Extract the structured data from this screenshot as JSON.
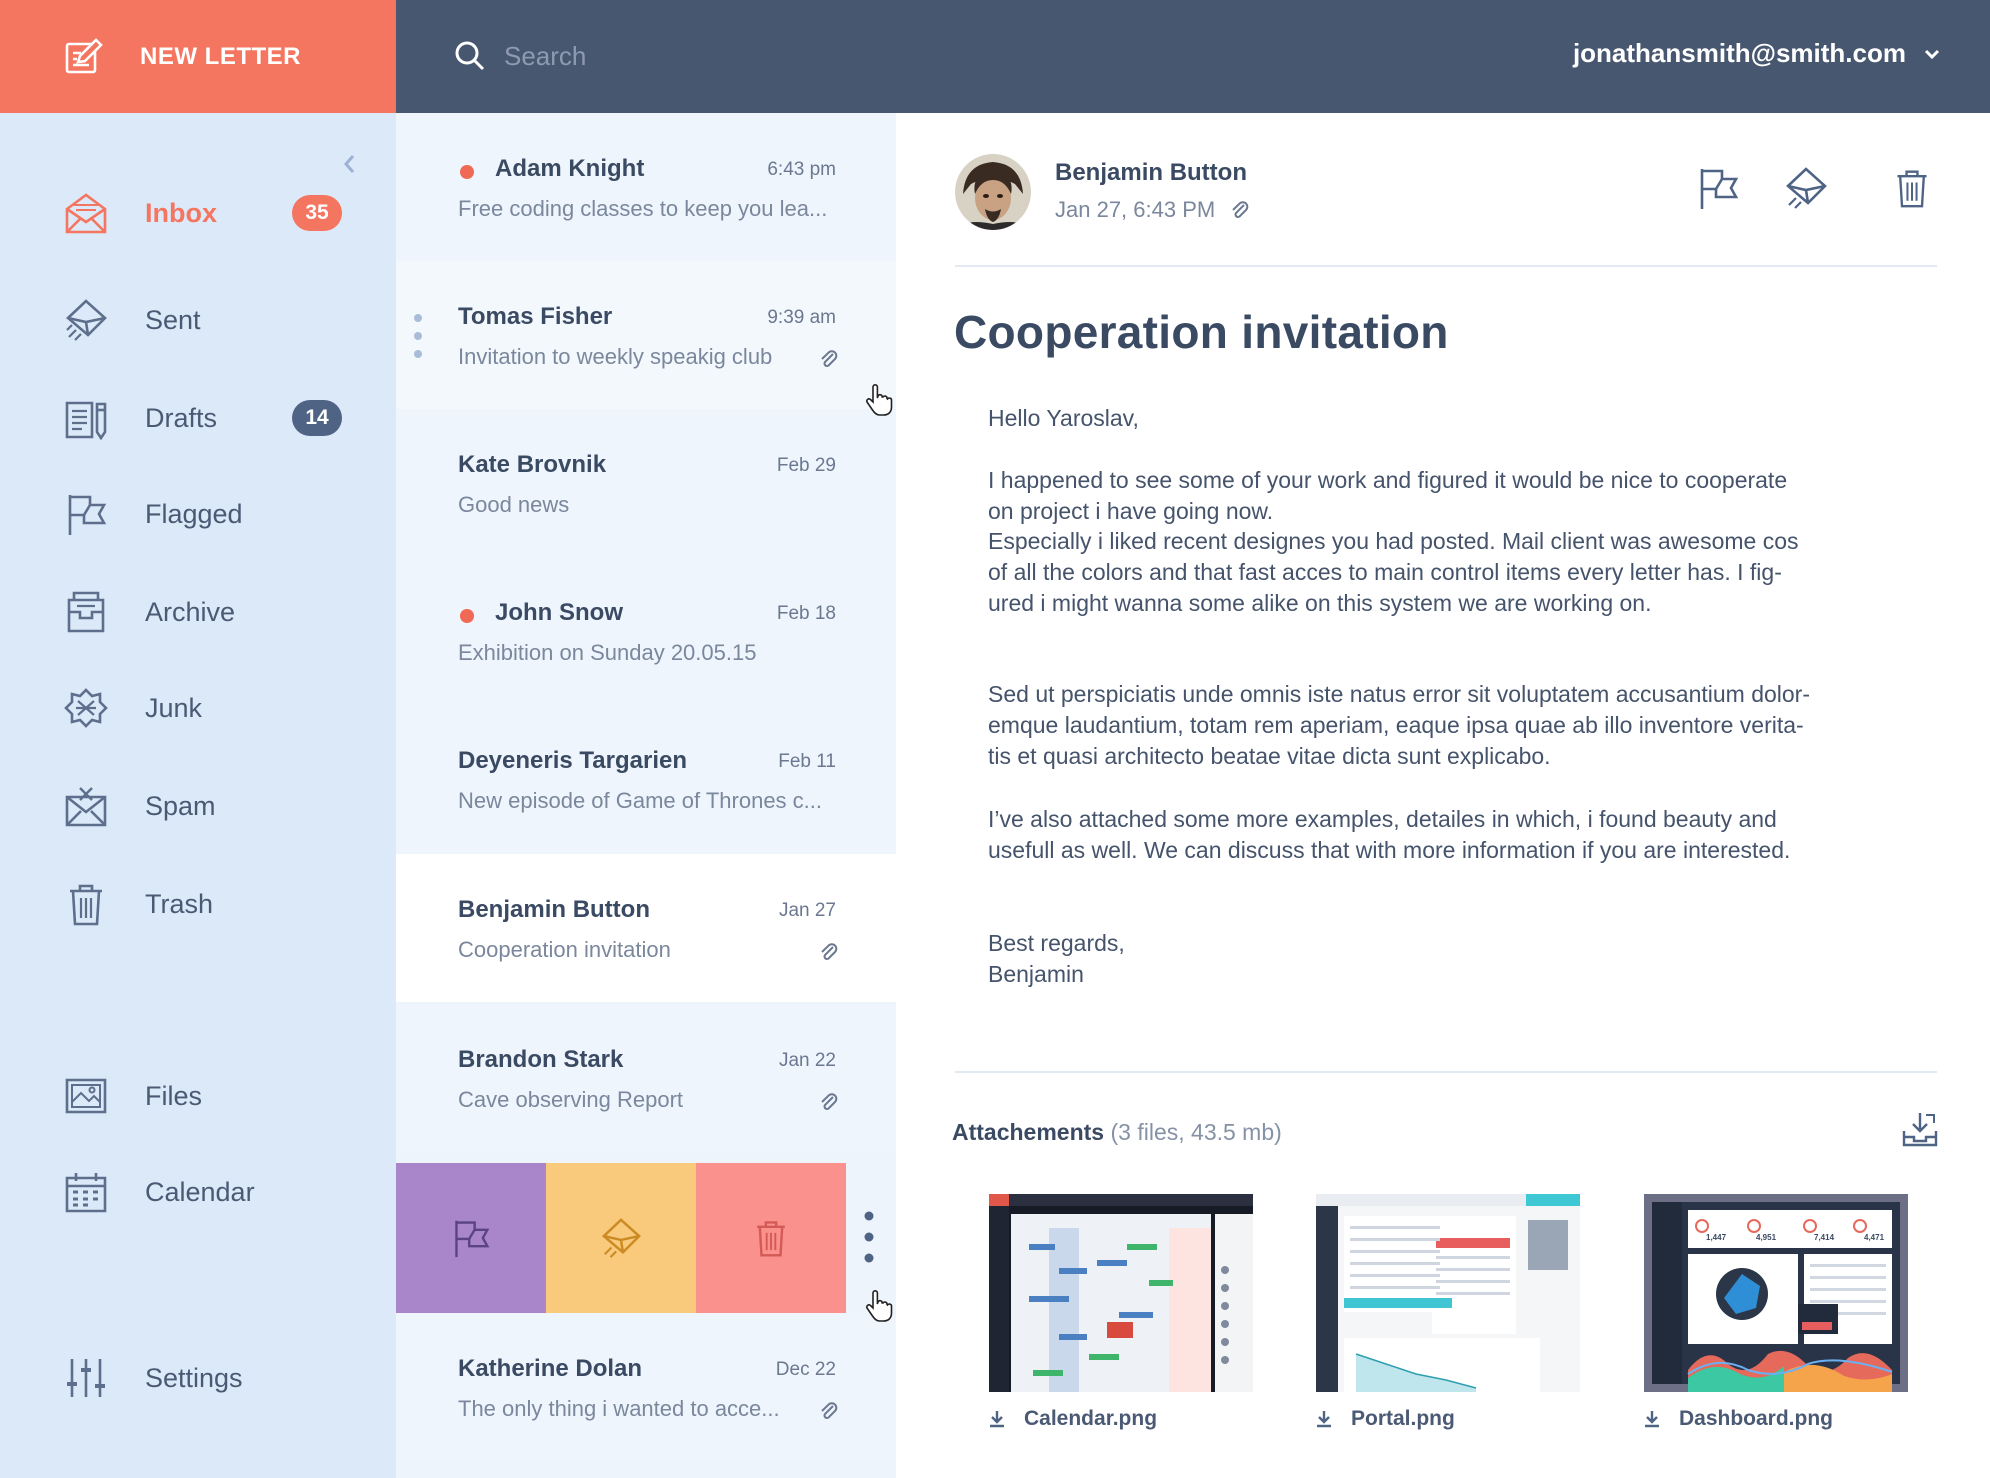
{
  "compose": {
    "label": "NEW LETTER",
    "icon": "compose-icon"
  },
  "search": {
    "placeholder": "Search",
    "icon": "search-icon"
  },
  "account": {
    "email": "jonathansmith@smith.com",
    "icon": "chevron-down-icon"
  },
  "colors": {
    "accent": "#f47560",
    "topbar": "#475770",
    "sidebar": "#dce9f8",
    "badge_blue": "#4f6385",
    "swipe_flag": "#a985c9",
    "swipe_read": "#f9c97c",
    "swipe_delete": "#fb918d"
  },
  "sidebar": {
    "items": [
      {
        "label": "Inbox",
        "badge": "35",
        "icon": "inbox-icon",
        "active": true
      },
      {
        "label": "Sent",
        "icon": "sent-icon"
      },
      {
        "label": "Drafts",
        "badge": "14",
        "icon": "drafts-icon"
      },
      {
        "label": "Flagged",
        "icon": "flag-icon"
      },
      {
        "label": "Archive",
        "icon": "archive-icon"
      },
      {
        "label": "Junk",
        "icon": "junk-icon"
      },
      {
        "label": "Spam",
        "icon": "spam-icon"
      },
      {
        "label": "Trash",
        "icon": "trash-icon"
      },
      {
        "label": "Files",
        "icon": "files-icon"
      },
      {
        "label": "Calendar",
        "icon": "calendar-icon"
      },
      {
        "label": "Settings",
        "icon": "settings-icon"
      }
    ]
  },
  "messages": [
    {
      "sender": "Adam Knight",
      "date": "6:43 pm",
      "subject": "Free coding classes to keep you lea...",
      "unread": true,
      "attachment": false
    },
    {
      "sender": "Tomas Fisher",
      "date": "9:39 am",
      "subject": "Invitation to weekly speakig club",
      "unread": false,
      "attachment": true
    },
    {
      "sender": "Kate Brovnik",
      "date": "Feb 29",
      "subject": "Good news",
      "unread": false,
      "attachment": false
    },
    {
      "sender": "John Snow",
      "date": "Feb 18",
      "subject": "Exhibition on Sunday 20.05.15",
      "unread": true,
      "attachment": false
    },
    {
      "sender": "Deyeneris Targarien",
      "date": "Feb 11",
      "subject": "New episode of Game of Thrones c...",
      "unread": false,
      "attachment": false
    },
    {
      "sender": "Benjamin Button",
      "date": "Jan 27",
      "subject": "Cooperation invitation",
      "unread": false,
      "attachment": true,
      "selected": true
    },
    {
      "sender": "Brandon Stark",
      "date": "Jan 22",
      "subject": "Cave observing Report",
      "unread": false,
      "attachment": true
    },
    {
      "sender": "Katherine Dolan",
      "date": "Dec 22",
      "subject": "The only thing i wanted to acce...",
      "unread": false,
      "attachment": true
    }
  ],
  "swipe_actions": [
    {
      "action": "flag",
      "icon": "flag-icon"
    },
    {
      "action": "mark-read",
      "icon": "envelope-icon"
    },
    {
      "action": "delete",
      "icon": "trash-icon"
    }
  ],
  "reader": {
    "from_name": "Benjamin Button",
    "from_date": "Jan 27, 6:43 PM",
    "subject": "Cooperation invitation",
    "toolbar": [
      "flag-icon",
      "mark-read-icon",
      "trash-icon"
    ],
    "body": {
      "greeting": "Hello Yaroslav,",
      "p1_l1": "I happened to see some of your work and figured it would be nice to cooperate",
      "p1_l2": "on project i have going now.",
      "p2_l1": "Especially i liked recent designes you had posted. Mail client was awesome cos",
      "p2_l2": "of all the colors and that fast acces to main control items every letter has. I fig-",
      "p2_l3": "ured i might wanna some alike on this system we are working on.",
      "p3_l1": "Sed ut perspiciatis unde omnis iste natus error sit voluptatem accusantium dolor-",
      "p3_l2": "emque laudantium, totam rem aperiam, eaque ipsa quae ab illo inventore verita-",
      "p3_l3": "tis et quasi architecto beatae vitae dicta sunt explicabo.",
      "p4_l1": "I’ve also attached some more examples, detailes in which, i found beauty and",
      "p4_l2": "usefull as well. We can discuss that with more information if you are interested.",
      "closing": "Best regards,",
      "signature": "Benjamin"
    },
    "attachments": {
      "title": "Attachements",
      "meta": "(3 files, 43.5 mb)",
      "files": [
        {
          "name": "Calendar.png",
          "icon": "download-icon"
        },
        {
          "name": "Portal.png",
          "icon": "download-icon"
        },
        {
          "name": "Dashboard.png",
          "icon": "download-icon"
        }
      ],
      "dashboard_stats": [
        "1,447",
        "4,951",
        "7,414",
        "4,471"
      ]
    }
  }
}
